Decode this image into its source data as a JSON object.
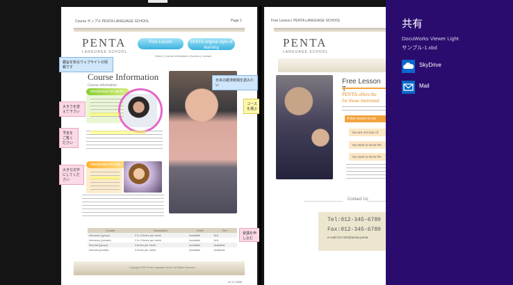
{
  "share_pane": {
    "title": "共有",
    "app_name": "DocuWorks Viewer Light",
    "file_name": "サンプル-1.xbd",
    "targets": [
      {
        "label": "SkyDrive",
        "icon": "cloud-icon"
      },
      {
        "label": "Mail",
        "icon": "mail-icon"
      }
    ],
    "background_color": "#2a0c6e"
  },
  "page1": {
    "header_left": "Course サンプル PENTA LANGUAGE SCHOOL",
    "header_right": "Page 1",
    "logo": "PENTA",
    "logo_sub": "LANGUAGE SCHOOL",
    "nav_buttons": [
      "Free Lesson",
      "PENTA original style of learning"
    ],
    "navbar_text": "Home | Course Information | Access | Contact",
    "title": "Course Information",
    "subtitle": "Course information",
    "pill_adult": "Introduction for adults",
    "pill_kids": "Introduction for kids",
    "notes": [
      "趣旨を知るウェブサイトの情報です",
      "日本の経済新聞を読みたい",
      "コースを選ぶ",
      "大きさを変えて下さい",
      "予定をご覧ください",
      "大きな文字にしてください",
      "受講を申し込む"
    ],
    "schedule_headers": [
      "Course",
      "Description",
      "Level",
      "Fee"
    ],
    "schedule_rows": [
      [
        "Intensive (group)",
        "2 to 3 times per week",
        "Available",
        "N/A"
      ],
      [
        "Intensive (private)",
        "2 to 3 times per week",
        "Available",
        "N/A"
      ],
      [
        "Normal (group)",
        "2 times per week",
        "Available",
        "Available"
      ],
      [
        "Normal (private)",
        "2 times per week",
        "Available",
        "Available"
      ]
    ],
    "copyright": "Copyright 2009 Penta Language School. All Rights Reserved.",
    "date": "07.17.2009"
  },
  "page2": {
    "header_left": "Free Lesson | PENTA LANGUAGE SCHOOL",
    "logo": "PENTA",
    "logo_sub": "LANGUAGE SCHOOL",
    "heading": "Free Lesson T",
    "orange_line1": "PENTA offers the",
    "orange_line2": "for those interested",
    "badge": "A free lesson is rec",
    "items": [
      "You are not sure of",
      "You want to know the",
      "You want to know the"
    ],
    "contact": "Contact Us",
    "tel": "Tel:012-345-6780",
    "fax": "Fax:012-345-6780",
    "email": "e-mail:012-345@penta.penta"
  }
}
